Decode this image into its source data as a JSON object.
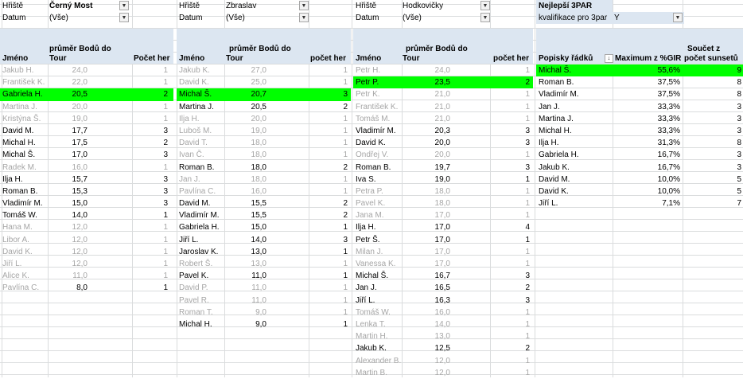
{
  "panels": [
    {
      "filters": [
        {
          "label": "Hřiště",
          "value": "Černý Most",
          "bold": true
        },
        {
          "label": "Datum",
          "value": "(Vše)",
          "bold": false
        }
      ],
      "headers": {
        "name": "Jméno",
        "value_line1": "průměr Bodů do",
        "value_line2": "Tour",
        "count": "Počet her"
      },
      "rows": [
        {
          "name": "Jakub H.",
          "value": "24,0",
          "count": "1",
          "dim": true
        },
        {
          "name": "František K.",
          "value": "22,0",
          "count": "1",
          "dim": true
        },
        {
          "name": "Gabriela H.",
          "value": "20,5",
          "count": "2",
          "highlight": true
        },
        {
          "name": "Martina J.",
          "value": "20,0",
          "count": "1",
          "dim": true
        },
        {
          "name": "Kristýna Š.",
          "value": "19,0",
          "count": "1",
          "dim": true
        },
        {
          "name": "David M.",
          "value": "17,7",
          "count": "3"
        },
        {
          "name": "Michal H.",
          "value": "17,5",
          "count": "2"
        },
        {
          "name": "Michal Š.",
          "value": "17,0",
          "count": "3"
        },
        {
          "name": "Radek M.",
          "value": "16,0",
          "count": "1",
          "dim": true
        },
        {
          "name": "Ilja H.",
          "value": "15,7",
          "count": "3"
        },
        {
          "name": "Roman B.",
          "value": "15,3",
          "count": "3"
        },
        {
          "name": "Vladimír M.",
          "value": "15,0",
          "count": "3"
        },
        {
          "name": "Tomáš W.",
          "value": "14,0",
          "count": "1"
        },
        {
          "name": "Hana M.",
          "value": "12,0",
          "count": "1",
          "dim": true
        },
        {
          "name": "Libor A.",
          "value": "12,0",
          "count": "1",
          "dim": true
        },
        {
          "name": "David K.",
          "value": "12,0",
          "count": "1",
          "dim": true
        },
        {
          "name": "Jiří L.",
          "value": "12,0",
          "count": "1",
          "dim": true
        },
        {
          "name": "Alice K.",
          "value": "11,0",
          "count": "1",
          "dim": true
        },
        {
          "name": "Pavlína C.",
          "value": "8,0",
          "count": "1",
          "dimname": true
        }
      ]
    },
    {
      "filters": [
        {
          "label": "Hřiště",
          "value": "Zbraslav",
          "bold": false
        },
        {
          "label": "Datum",
          "value": "(Vše)",
          "bold": false
        }
      ],
      "headers": {
        "name": "Jméno",
        "value_line1": "průměr Bodů do",
        "value_line2": "Tour",
        "count": "počet her"
      },
      "rows": [
        {
          "name": "Jakub K.",
          "value": "27,0",
          "count": "1",
          "dim": true
        },
        {
          "name": "David K.",
          "value": "25,0",
          "count": "1",
          "dim": true
        },
        {
          "name": "Michal Š.",
          "value": "20,7",
          "count": "3",
          "highlight": true
        },
        {
          "name": "Martina J.",
          "value": "20,5",
          "count": "2"
        },
        {
          "name": "Ilja H.",
          "value": "20,0",
          "count": "1",
          "dim": true
        },
        {
          "name": "Luboš M.",
          "value": "19,0",
          "count": "1",
          "dim": true
        },
        {
          "name": "David T.",
          "value": "18,0",
          "count": "1",
          "dim": true
        },
        {
          "name": "Ivan Č.",
          "value": "18,0",
          "count": "1",
          "dim": true
        },
        {
          "name": "Roman B.",
          "value": "18,0",
          "count": "2"
        },
        {
          "name": "Jan J.",
          "value": "18,0",
          "count": "1",
          "dim": true
        },
        {
          "name": "Pavlína C.",
          "value": "16,0",
          "count": "1",
          "dim": true
        },
        {
          "name": "David M.",
          "value": "15,5",
          "count": "2"
        },
        {
          "name": "Vladimír M.",
          "value": "15,5",
          "count": "2"
        },
        {
          "name": "Gabriela H.",
          "value": "15,0",
          "count": "1"
        },
        {
          "name": "Jiří L.",
          "value": "14,0",
          "count": "3"
        },
        {
          "name": "Jaroslav K.",
          "value": "13,0",
          "count": "1"
        },
        {
          "name": "Robert Š.",
          "value": "13,0",
          "count": "1",
          "dim": true
        },
        {
          "name": "Pavel K.",
          "value": "11,0",
          "count": "1"
        },
        {
          "name": "David P.",
          "value": "11,0",
          "count": "1",
          "dim": true
        },
        {
          "name": "Pavel R.",
          "value": "11,0",
          "count": "1",
          "dim": true
        },
        {
          "name": "Roman T.",
          "value": "9,0",
          "count": "1",
          "dim": true
        },
        {
          "name": "Michal H.",
          "value": "9,0",
          "count": "1"
        }
      ]
    },
    {
      "filters": [
        {
          "label": "Hřiště",
          "value": "Hodkovičky",
          "bold": false
        },
        {
          "label": "Datum",
          "value": "(Vše)",
          "bold": false
        }
      ],
      "headers": {
        "name": "Jméno",
        "value_line1": "průměr Bodů do",
        "value_line2": "Tour",
        "count": "počet her"
      },
      "rows": [
        {
          "name": "Petr H.",
          "value": "24,0",
          "count": "1",
          "dim": true
        },
        {
          "name": "Petr P.",
          "value": "23,5",
          "count": "2",
          "highlight": true
        },
        {
          "name": "Petr K.",
          "value": "21,0",
          "count": "1",
          "dim": true
        },
        {
          "name": "František K.",
          "value": "21,0",
          "count": "1",
          "dim": true
        },
        {
          "name": "Tomáš M.",
          "value": "21,0",
          "count": "1",
          "dim": true
        },
        {
          "name": "Vladimír M.",
          "value": "20,3",
          "count": "3"
        },
        {
          "name": "David K.",
          "value": "20,0",
          "count": "3"
        },
        {
          "name": "Ondřej V.",
          "value": "20,0",
          "count": "1",
          "dim": true
        },
        {
          "name": "Roman B.",
          "value": "19,7",
          "count": "3"
        },
        {
          "name": "Iva S.",
          "value": "19,0",
          "count": "1"
        },
        {
          "name": "Petra P.",
          "value": "18,0",
          "count": "1",
          "dim": true
        },
        {
          "name": "Pavel K.",
          "value": "18,0",
          "count": "1",
          "dim": true
        },
        {
          "name": "Jana M.",
          "value": "17,0",
          "count": "1",
          "dim": true
        },
        {
          "name": "Ilja H.",
          "value": "17,0",
          "count": "4"
        },
        {
          "name": "Petr Š.",
          "value": "17,0",
          "count": "1"
        },
        {
          "name": "Milan J.",
          "value": "17,0",
          "count": "1",
          "dim": true
        },
        {
          "name": "Vanessa K.",
          "value": "17,0",
          "count": "1",
          "dim": true
        },
        {
          "name": "Michal Š.",
          "value": "16,7",
          "count": "3"
        },
        {
          "name": "Jan J.",
          "value": "16,5",
          "count": "2"
        },
        {
          "name": "Jiří L.",
          "value": "16,3",
          "count": "3"
        },
        {
          "name": "Tomáš W.",
          "value": "16,0",
          "count": "1",
          "dim": true
        },
        {
          "name": "Lenka T.",
          "value": "14,0",
          "count": "1",
          "dim": true
        },
        {
          "name": "Martin H.",
          "value": "13,0",
          "count": "1",
          "dim": true
        },
        {
          "name": "Jakub K.",
          "value": "12,5",
          "count": "2"
        },
        {
          "name": "Alexander B.",
          "value": "12,0",
          "count": "1",
          "dim": true
        },
        {
          "name": "Martin B.",
          "value": "12,0",
          "count": "1",
          "dim": true
        }
      ]
    },
    {
      "filters": [
        {
          "label": "Nejlepší 3PAR",
          "value": "",
          "bold": true,
          "shaded": true
        },
        {
          "label": "kvalifikace pro 3par",
          "value": "Y",
          "bold": false,
          "shaded": true
        }
      ],
      "headers": {
        "name": "Popisky řádků",
        "value_line1": "",
        "value_line2": "Maximum z %GIR",
        "count_line1": "Součet z",
        "count": "počet sunsetů"
      },
      "rows": [
        {
          "name": "Michal Š.",
          "value": "55,6%",
          "count": "9",
          "highlight": true
        },
        {
          "name": "Roman B.",
          "value": "37,5%",
          "count": "8"
        },
        {
          "name": "Vladimír M.",
          "value": "37,5%",
          "count": "8"
        },
        {
          "name": "Jan J.",
          "value": "33,3%",
          "count": "3"
        },
        {
          "name": "Martina J.",
          "value": "33,3%",
          "count": "3"
        },
        {
          "name": "Michal H.",
          "value": "33,3%",
          "count": "3"
        },
        {
          "name": "Ilja H.",
          "value": "31,3%",
          "count": "8"
        },
        {
          "name": "Gabriela H.",
          "value": "16,7%",
          "count": "3"
        },
        {
          "name": "Jakub K.",
          "value": "16,7%",
          "count": "3"
        },
        {
          "name": "David M.",
          "value": "10,0%",
          "count": "5"
        },
        {
          "name": "David K.",
          "value": "10,0%",
          "count": "5"
        },
        {
          "name": "Jiří L.",
          "value": "7,1%",
          "count": "7"
        }
      ]
    }
  ],
  "icons": {
    "filter": "filter-funnel-icon",
    "sort": "sort-descending-icon"
  }
}
